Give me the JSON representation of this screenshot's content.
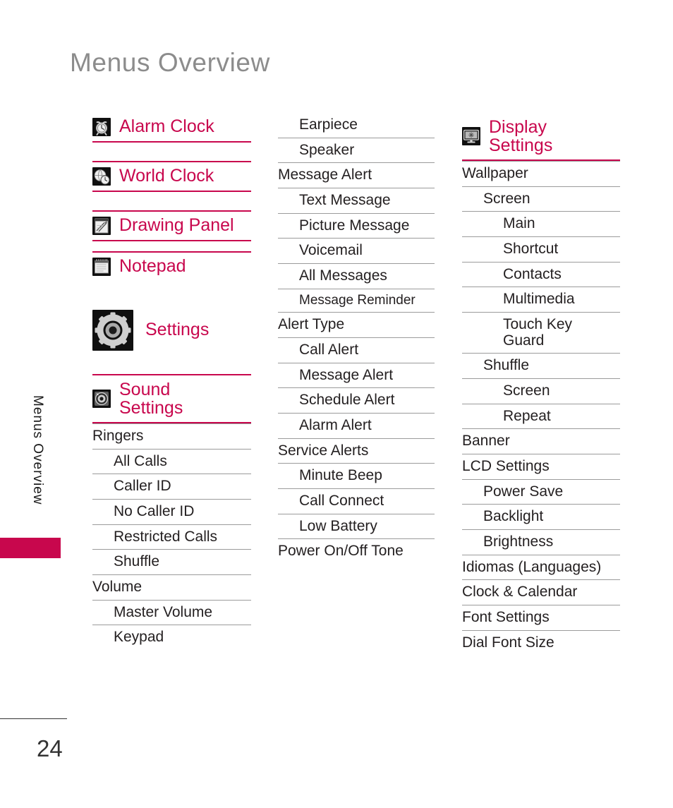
{
  "page": {
    "title": "Menus Overview",
    "side_label": "Menus Overview",
    "number": "24",
    "accent_color": "#c8074d",
    "title_color": "#8c8c8c",
    "text_color": "#231f20",
    "rule_color": "#9b9b9b"
  },
  "columns": [
    {
      "id": "column-1",
      "blocks": [
        {
          "type": "head",
          "icon": "alarm-clock-icon",
          "label": "Alarm Clock",
          "rules": "both"
        },
        {
          "type": "spacer"
        },
        {
          "type": "head",
          "icon": "world-clock-icon",
          "label": "World Clock",
          "rules": "both"
        },
        {
          "type": "spacer"
        },
        {
          "type": "head",
          "icon": "drawing-panel-icon",
          "label": "Drawing Panel",
          "rules": "both"
        },
        {
          "type": "spacer-sm"
        },
        {
          "type": "head",
          "icon": "notepad-icon",
          "label": "Notepad",
          "rules": "top"
        },
        {
          "type": "spacer-lg"
        },
        {
          "type": "head",
          "icon": "settings-gear-icon",
          "label": "Settings",
          "rules": "none",
          "big_icon": true
        },
        {
          "type": "spacer"
        },
        {
          "type": "head",
          "icon": "sound-settings-icon",
          "label": "Sound\nSettings",
          "rules": "both",
          "two_line": true
        },
        {
          "type": "item",
          "level": 0,
          "label": "Ringers"
        },
        {
          "type": "item",
          "level": 1,
          "label": "All Calls"
        },
        {
          "type": "item",
          "level": 1,
          "label": "Caller ID"
        },
        {
          "type": "item",
          "level": 1,
          "label": "No Caller ID"
        },
        {
          "type": "item",
          "level": 1,
          "label": "Restricted Calls"
        },
        {
          "type": "item",
          "level": 1,
          "label": "Shuffle"
        },
        {
          "type": "item",
          "level": 0,
          "label": "Volume"
        },
        {
          "type": "item",
          "level": 1,
          "label": "Master Volume"
        },
        {
          "type": "item",
          "level": 1,
          "label": "Keypad"
        }
      ]
    },
    {
      "id": "column-2",
      "blocks": [
        {
          "type": "item",
          "level": 1,
          "label": "Earpiece"
        },
        {
          "type": "item",
          "level": 1,
          "label": "Speaker"
        },
        {
          "type": "item",
          "level": 0,
          "label": "Message Alert"
        },
        {
          "type": "item",
          "level": 1,
          "label": "Text Message"
        },
        {
          "type": "item",
          "level": 1,
          "label": "Picture Message"
        },
        {
          "type": "item",
          "level": 1,
          "label": "Voicemail"
        },
        {
          "type": "item",
          "level": 1,
          "label": "All Messages"
        },
        {
          "type": "item",
          "level": 1,
          "label": "Message Reminder",
          "small": true
        },
        {
          "type": "item",
          "level": 0,
          "label": "Alert Type"
        },
        {
          "type": "item",
          "level": 1,
          "label": "Call Alert"
        },
        {
          "type": "item",
          "level": 1,
          "label": "Message Alert"
        },
        {
          "type": "item",
          "level": 1,
          "label": "Schedule Alert"
        },
        {
          "type": "item",
          "level": 1,
          "label": "Alarm Alert"
        },
        {
          "type": "item",
          "level": 0,
          "label": "Service Alerts"
        },
        {
          "type": "item",
          "level": 1,
          "label": "Minute Beep"
        },
        {
          "type": "item",
          "level": 1,
          "label": "Call Connect"
        },
        {
          "type": "item",
          "level": 1,
          "label": "Low Battery"
        },
        {
          "type": "item",
          "level": 0,
          "label": "Power On/Off Tone"
        }
      ]
    },
    {
      "id": "column-3",
      "blocks": [
        {
          "type": "head",
          "icon": "display-settings-icon",
          "label": "Display\nSettings",
          "rules": "both",
          "two_line": true
        },
        {
          "type": "item",
          "level": 0,
          "label": "Wallpaper"
        },
        {
          "type": "item",
          "level": 1,
          "label": "Screen"
        },
        {
          "type": "item",
          "level": 2,
          "label": "Main"
        },
        {
          "type": "item",
          "level": 2,
          "label": "Shortcut"
        },
        {
          "type": "item",
          "level": 2,
          "label": "Contacts"
        },
        {
          "type": "item",
          "level": 2,
          "label": "Multimedia"
        },
        {
          "type": "item",
          "level": 2,
          "label": "Touch Key\nGuard",
          "two_line": true
        },
        {
          "type": "item",
          "level": 1,
          "label": "Shuffle"
        },
        {
          "type": "item",
          "level": 2,
          "label": "Screen"
        },
        {
          "type": "item",
          "level": 2,
          "label": "Repeat"
        },
        {
          "type": "item",
          "level": 0,
          "label": "Banner"
        },
        {
          "type": "item",
          "level": 0,
          "label": "LCD Settings"
        },
        {
          "type": "item",
          "level": 1,
          "label": "Power Save"
        },
        {
          "type": "item",
          "level": 1,
          "label": "Backlight"
        },
        {
          "type": "item",
          "level": 1,
          "label": "Brightness"
        },
        {
          "type": "item",
          "level": 0,
          "label": "Idiomas (Languages)"
        },
        {
          "type": "item",
          "level": 0,
          "label": "Clock & Calendar"
        },
        {
          "type": "item",
          "level": 0,
          "label": "Font Settings"
        },
        {
          "type": "item",
          "level": 0,
          "label": "Dial Font Size"
        }
      ]
    }
  ]
}
